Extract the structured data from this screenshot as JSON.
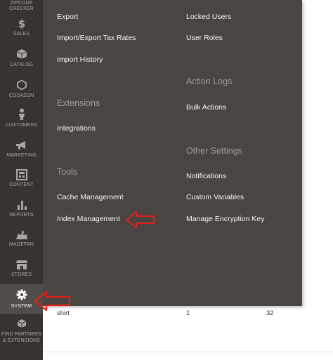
{
  "sidebar": {
    "items": [
      {
        "label": "ZIPCODE CHECKER",
        "icon": "zipcode-icon"
      },
      {
        "label": "SALES",
        "icon": "dollar-icon"
      },
      {
        "label": "CATALOG",
        "icon": "box-icon"
      },
      {
        "label": "CODAZON",
        "icon": "hexagon-icon"
      },
      {
        "label": "CUSTOMERS",
        "icon": "person-icon"
      },
      {
        "label": "MARKETING",
        "icon": "megaphone-icon"
      },
      {
        "label": "CONTENT",
        "icon": "layout-icon"
      },
      {
        "label": "REPORTS",
        "icon": "bar-chart-icon"
      },
      {
        "label": "MAGEFAN",
        "icon": "magefan-icon"
      },
      {
        "label": "STORES",
        "icon": "store-icon"
      },
      {
        "label": "SYSTEM",
        "icon": "gear-icon"
      },
      {
        "label": "FIND PARTNERS & EXTENSIONS",
        "icon": "cubes-icon"
      }
    ]
  },
  "flyout": {
    "col1": {
      "links_top": [
        "Export",
        "Import/Export Tax Rates",
        "Import History"
      ],
      "extensions_heading": "Extensions",
      "extensions_links": [
        "Integrations"
      ],
      "tools_heading": "Tools",
      "tools_links": [
        "Cache Management",
        "Index Management"
      ]
    },
    "col2": {
      "links_top": [
        "Locked Users",
        "User Roles"
      ],
      "action_logs_heading": "Action Logs",
      "action_logs_links": [
        "Bulk Actions"
      ],
      "other_heading": "Other Settings",
      "other_links": [
        "Notifications",
        "Custom Variables",
        "Manage Encryption Key"
      ]
    }
  },
  "grid_row": {
    "cells": [
      "shirt",
      "1",
      "32"
    ]
  },
  "colors": {
    "annotation_arrow": "#e0201b",
    "sidebar_bg": "#373330",
    "flyout_bg": "#4a4542"
  }
}
